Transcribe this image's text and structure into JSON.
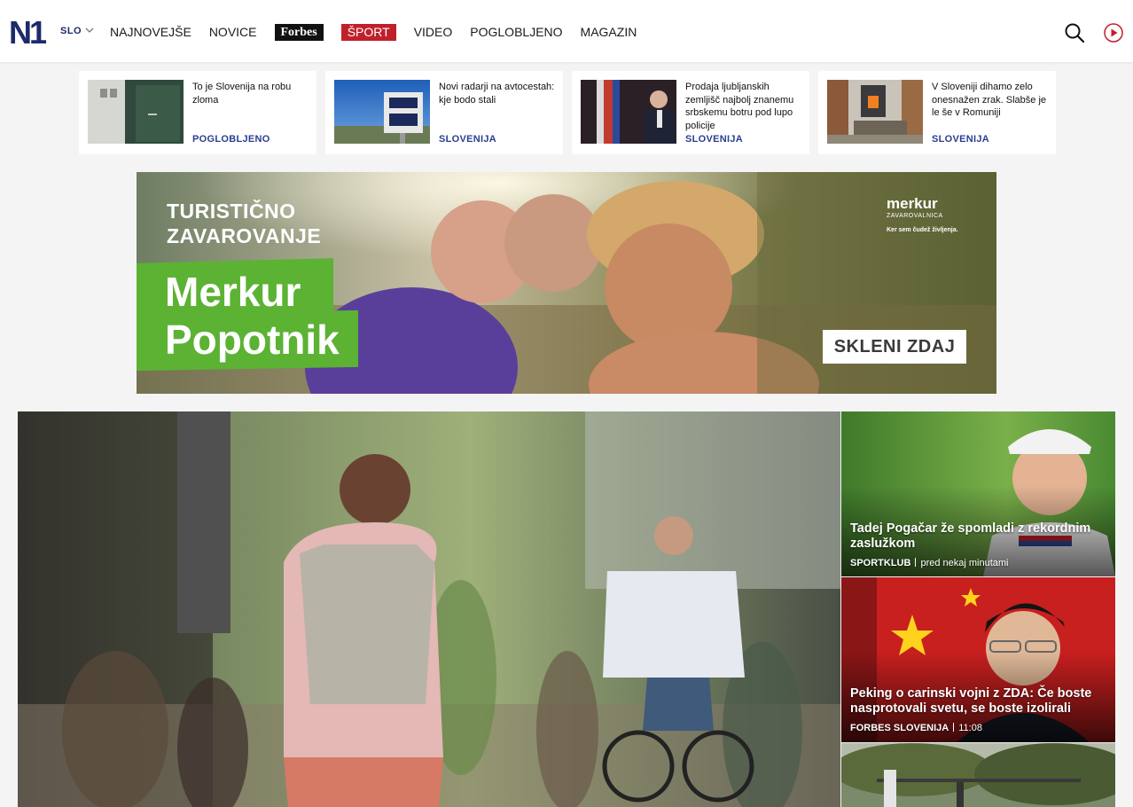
{
  "header": {
    "logo_text": "N1",
    "edition": "SLO",
    "nav": [
      {
        "label": "NAJNOVEJŠE"
      },
      {
        "label": "NOVICE"
      },
      {
        "label": "Forbes"
      },
      {
        "label": "ŠPORT"
      },
      {
        "label": "VIDEO"
      },
      {
        "label": "POGLOBLJENO"
      },
      {
        "label": "MAGAZIN"
      }
    ],
    "icons": {
      "search": "search-icon",
      "live": "play-icon"
    },
    "colors": {
      "brand_navy": "#1d2a6b",
      "sport_red": "#c0202a",
      "forbes_black": "#111111"
    }
  },
  "top_stories": [
    {
      "title": "To je Slovenija na robu zloma",
      "category": "POGLOBLJENO"
    },
    {
      "title": "Novi radarji na avtocestah: kje bodo stali",
      "category": "SLOVENIJA"
    },
    {
      "title": "Prodaja ljubljanskih zemljišč najbolj znanemu srbskemu botru pod lupo policije",
      "category": "SLOVENIJA"
    },
    {
      "title": "V Sloveniji dihamo zelo onesnažen zrak. Slabše je le še v Romuniji",
      "category": "SLOVENIJA"
    }
  ],
  "ad": {
    "kicker_line1": "TURISTIČNO",
    "kicker_line2": "ZAVAROVANJE",
    "headline_line1": "Merkur",
    "headline_line2": "Popotnik",
    "brand": "merkur",
    "brand_sub": "ZAVAROVALNICA",
    "brand_tagline": "Ker sem čudež življenja.",
    "cta": "SKLENI ZDAJ",
    "accent": "#5bb233"
  },
  "side_stories": [
    {
      "title": "Tadej Pogačar že spomladi z rekordnim zaslužkom",
      "source": "SPORTKLUB",
      "time": "pred nekaj minutami"
    },
    {
      "title": "Peking o carinski vojni z ZDA: Če boste nasprotovali svetu, se boste izolirali",
      "source": "FORBES SLOVENIJA",
      "time": "11:08"
    }
  ]
}
